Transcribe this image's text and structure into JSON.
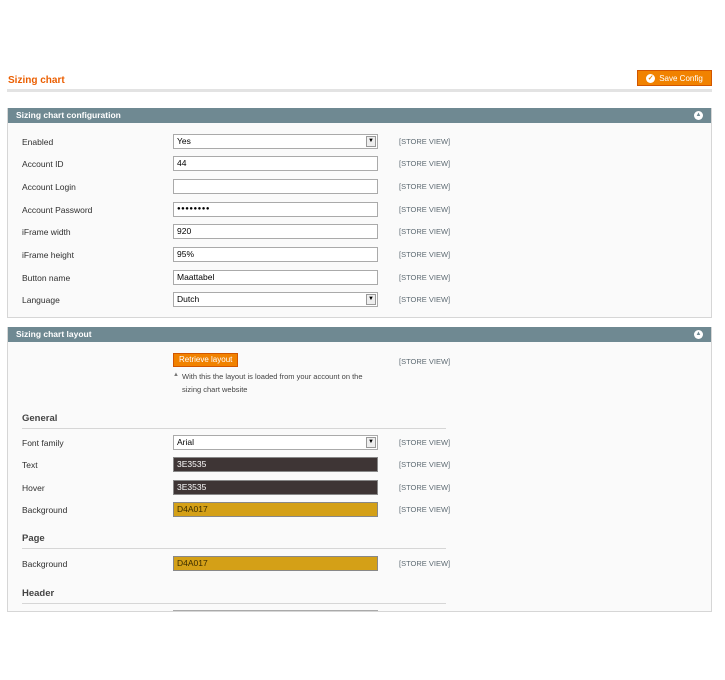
{
  "page": {
    "title": "Sizing chart",
    "save_label": "Save Config",
    "save_icon": "check-icon"
  },
  "config": {
    "title": "Sizing chart configuration",
    "scope": "[STORE VIEW]",
    "enabled": {
      "label": "Enabled",
      "value": "Yes"
    },
    "account_id": {
      "label": "Account ID",
      "value": "44"
    },
    "account_login": {
      "label": "Account Login",
      "value": ""
    },
    "account_password": {
      "label": "Account Password",
      "value": "●●●●●●●●"
    },
    "iframe_width": {
      "label": "iFrame width",
      "value": "920"
    },
    "iframe_height": {
      "label": "iFrame height",
      "value": "95%"
    },
    "button_name": {
      "label": "Button name",
      "value": "Maattabel"
    },
    "language": {
      "label": "Language",
      "value": "Dutch"
    }
  },
  "layout": {
    "title": "Sizing chart layout",
    "scope": "[STORE VIEW]",
    "retrieve_label": "Retrieve layout",
    "retrieve_note_line1": "With this the layout is loaded from your account on the",
    "retrieve_note_line2": "sizing chart website",
    "general_heading": "General",
    "font_family": {
      "label": "Font family",
      "value": "Arial"
    },
    "text": {
      "label": "Text",
      "value": "3E3535",
      "color": "#3E3535"
    },
    "hover": {
      "label": "Hover",
      "value": "3E3535",
      "color": "#3E3535"
    },
    "background": {
      "label": "Background",
      "value": "D4A017",
      "color": "#D4A017"
    },
    "page_heading": "Page",
    "page_background": {
      "label": "Background",
      "value": "D4A017",
      "color": "#D4A017"
    },
    "header_heading": "Header"
  }
}
